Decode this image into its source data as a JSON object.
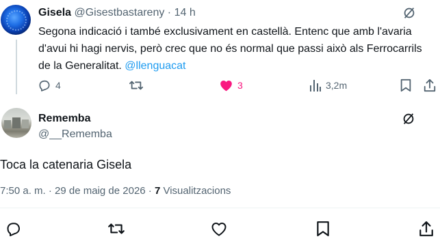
{
  "parent_tweet": {
    "author_name": "Gisela",
    "handle": "@Gisestbastareny",
    "separator": "·",
    "time": "14 h",
    "text_before_mention": "Segona indicació i també exclusivament en castellà. Entenc que amb l'avaria d'avui hi hagi nervis, però crec que no és normal que passi això als Ferrocarrils de la Generalitat. ",
    "mention": "@llenguacat",
    "replies": "4",
    "likes": "3",
    "views": "3,2m"
  },
  "main_tweet": {
    "author_name": "Rememba",
    "handle": "@__Rememba",
    "text": "Toca la catenaria Gisela",
    "time_date": "7:50 a. m. · 29 de maig de 2026 · ",
    "views_count": "7",
    "views_label": " Visualitzacions"
  },
  "icons": [
    "grok-icon",
    "reply-icon",
    "retweet-icon",
    "like-icon",
    "views-icon",
    "bookmark-icon",
    "share-icon"
  ],
  "colors": {
    "like_active": "#f91880",
    "mention": "#1d9bf0",
    "secondary_text": "#536471"
  }
}
